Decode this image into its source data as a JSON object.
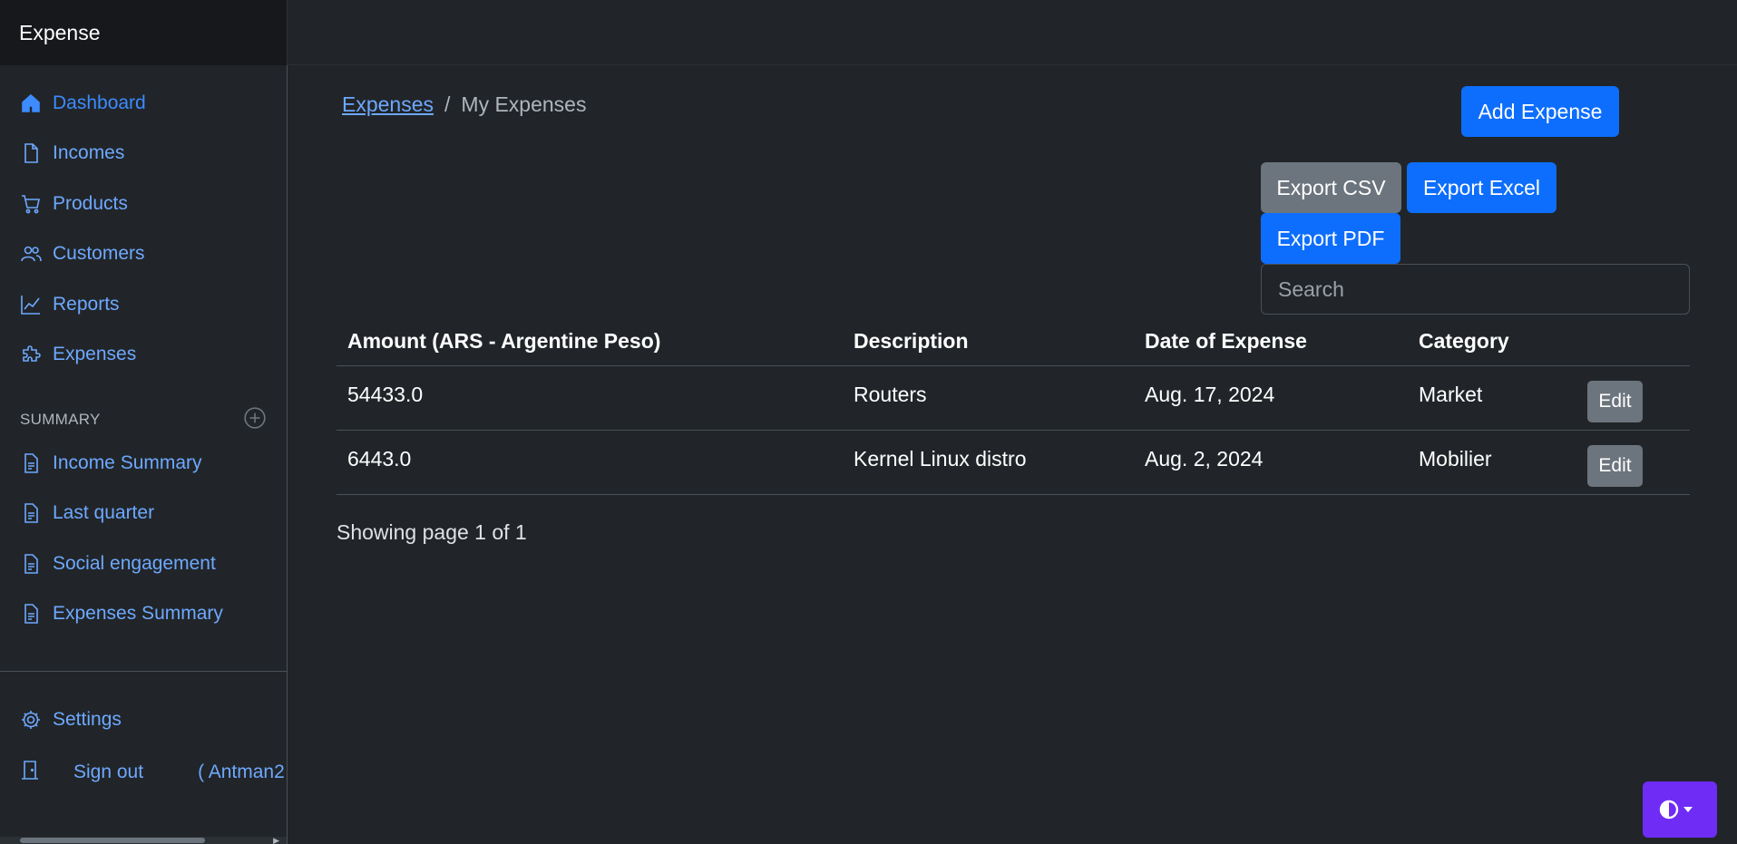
{
  "app": {
    "brand": "Expense"
  },
  "sidebar": {
    "items": [
      {
        "label": "Dashboard",
        "icon": "house-icon"
      },
      {
        "label": "Incomes",
        "icon": "file-icon"
      },
      {
        "label": "Products",
        "icon": "cart-icon"
      },
      {
        "label": "Customers",
        "icon": "people-icon"
      },
      {
        "label": "Reports",
        "icon": "graph-icon"
      },
      {
        "label": "Expenses",
        "icon": "puzzle-icon"
      }
    ],
    "summary_heading": "SUMMARY",
    "summary_items": [
      {
        "label": "Income Summary",
        "icon": "file-text-icon"
      },
      {
        "label": "Last quarter",
        "icon": "file-text-icon"
      },
      {
        "label": "Social engagement",
        "icon": "file-text-icon"
      },
      {
        "label": "Expenses Summary",
        "icon": "file-text-icon"
      }
    ],
    "settings": "Settings",
    "signout": "Sign out",
    "user": "( Antman2"
  },
  "breadcrumb": {
    "root": "Expenses",
    "current": "My Expenses",
    "separator": "/"
  },
  "toolbar": {
    "add_label": "Add Expense",
    "export_csv": "Export CSV",
    "export_excel": "Export Excel",
    "export_pdf": "Export PDF",
    "search_placeholder": "Search"
  },
  "table": {
    "headers": [
      "Amount (ARS - Argentine Peso)",
      "Description",
      "Date of Expense",
      "Category"
    ],
    "rows": [
      {
        "amount": "54433.0",
        "description": "Routers",
        "date": "Aug. 17, 2024",
        "category": "Market",
        "action": "Edit"
      },
      {
        "amount": "6443.0",
        "description": "Kernel Linux distro",
        "date": "Aug. 2, 2024",
        "category": "Mobilier",
        "action": "Edit"
      }
    ]
  },
  "pagination": {
    "text": "Showing page 1 of 1"
  },
  "colors": {
    "primary": "#0d6efd",
    "secondary": "#6c757d",
    "link": "#6ea8fe",
    "toggle": "#6f2cf5",
    "background": "#212529"
  }
}
